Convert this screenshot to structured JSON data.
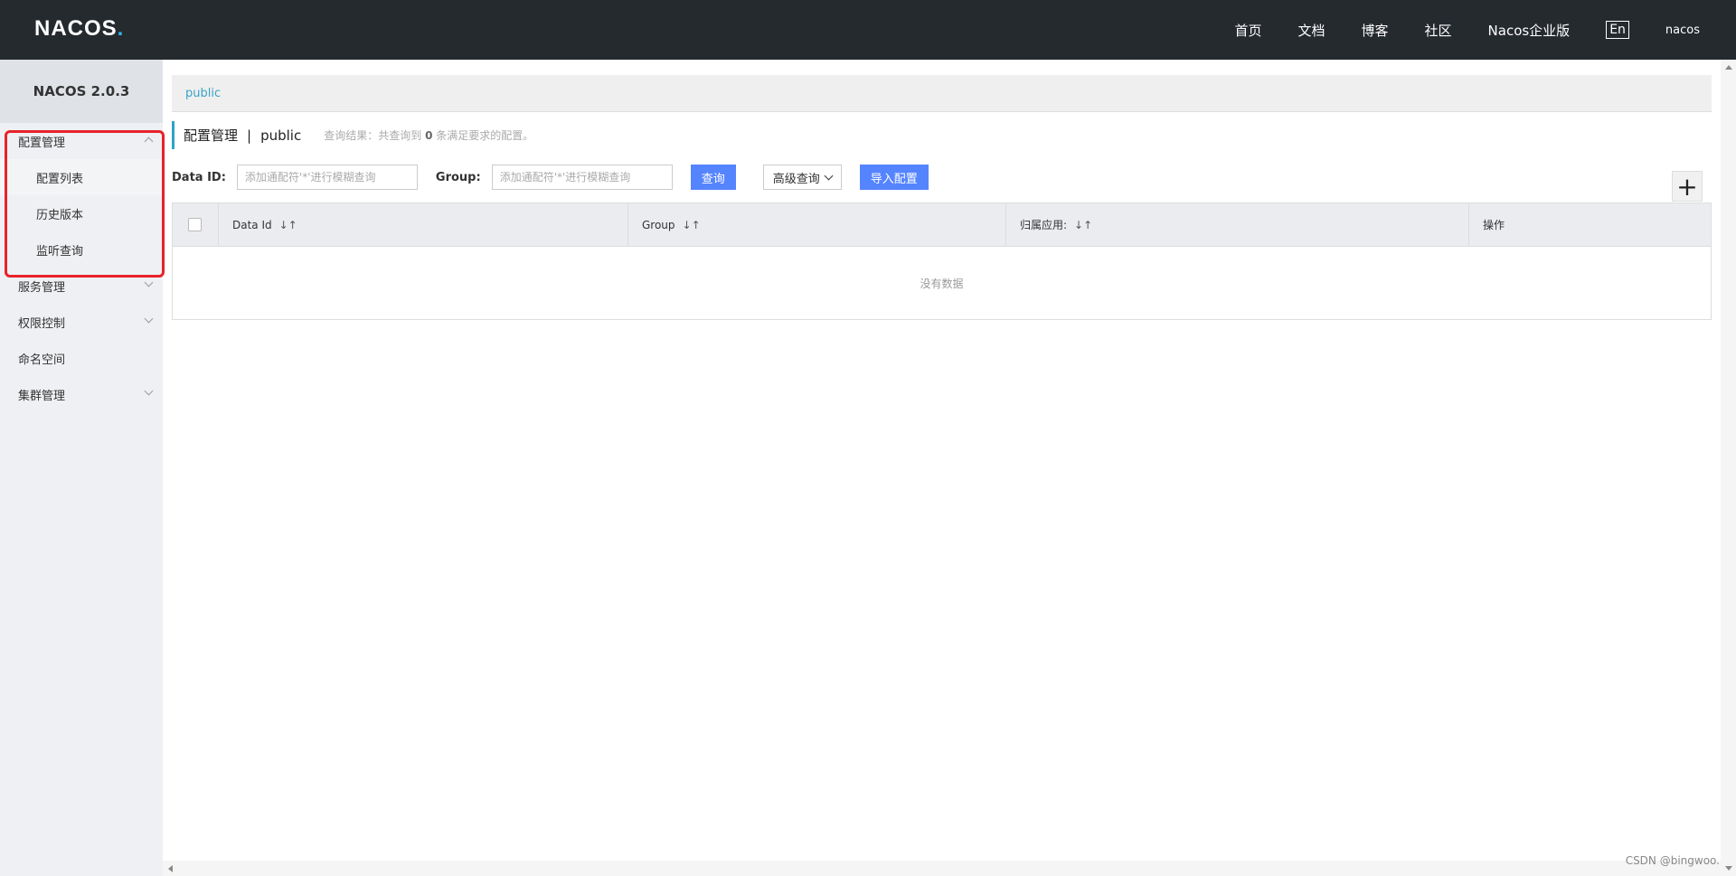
{
  "header": {
    "logo": "NACOS",
    "logo_dot": ".",
    "nav": [
      "首页",
      "文档",
      "博客",
      "社区",
      "Nacos企业版"
    ],
    "lang": "En",
    "user": "nacos"
  },
  "sidebar": {
    "version": "NACOS 2.0.3",
    "groups": [
      {
        "label": "配置管理",
        "expanded": true,
        "items": [
          "配置列表",
          "历史版本",
          "监听查询"
        ]
      },
      {
        "label": "服务管理",
        "expanded": false
      },
      {
        "label": "权限控制",
        "expanded": false
      },
      {
        "label": "命名空间"
      },
      {
        "label": "集群管理",
        "expanded": false
      }
    ]
  },
  "main": {
    "namespace": "public",
    "title": "配置管理",
    "separator": "|",
    "title_ns": "public",
    "result_prefix": "查询结果：共查询到",
    "result_count": "0",
    "result_suffix": "条满足要求的配置。",
    "filters": {
      "dataid_label": "Data ID:",
      "dataid_placeholder": "添加通配符'*'进行模糊查询",
      "group_label": "Group:",
      "group_placeholder": "添加通配符'*'进行模糊查询",
      "query_button": "查询",
      "advanced_button": "高级查询",
      "import_button": "导入配置",
      "add_button": "+"
    },
    "table": {
      "columns": [
        "Data Id",
        "Group",
        "归属应用:",
        "操作"
      ],
      "sort_icon": "↓↑",
      "empty_text": "没有数据"
    }
  },
  "watermark": "CSDN @bingwoo.",
  "colors": {
    "header_bg": "#252a2f",
    "primary": "#5584ff",
    "highlight": "#e8222a",
    "accent": "#2fa3c8"
  }
}
